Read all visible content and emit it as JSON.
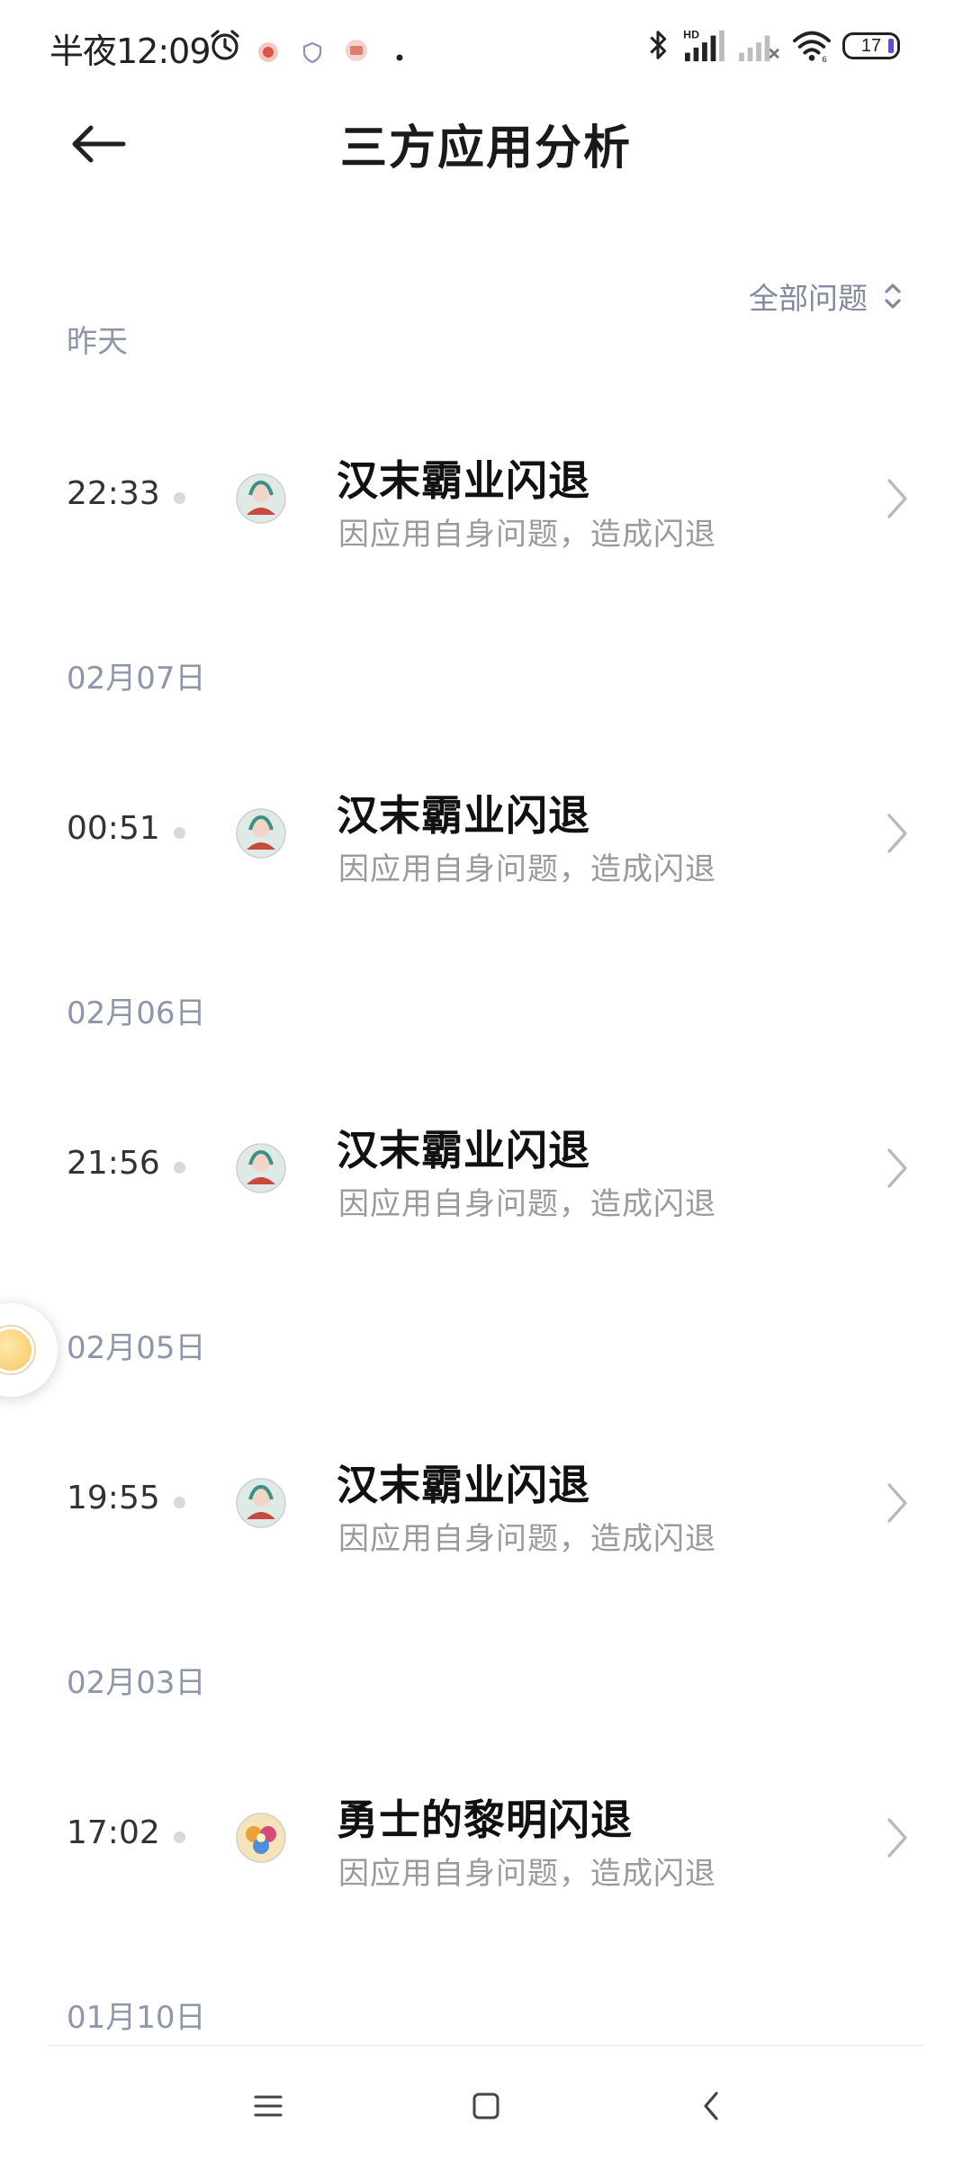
{
  "status_bar": {
    "time": "半夜12:09",
    "battery": "17",
    "icons": [
      "alarm-icon",
      "app-notification-icon",
      "shield-notification-icon",
      "app-notification-icon",
      "more-dot-icon",
      "bluetooth-icon",
      "signal-hd-icon",
      "signal-no-service-icon",
      "wifi-icon",
      "battery-icon"
    ]
  },
  "header": {
    "title": "三方应用分析",
    "back_icon": "arrow-left-icon"
  },
  "filter": {
    "label": "全部问题",
    "icon": "sort-updown-icon"
  },
  "sections": [
    {
      "date": "昨天",
      "items": [
        {
          "time": "22:33",
          "title": "汉末霸业闪退",
          "subtitle": "因应用自身问题，造成闪退",
          "icon": "app-icon-hanmo"
        }
      ]
    },
    {
      "date": "02月07日",
      "items": [
        {
          "time": "00:51",
          "title": "汉末霸业闪退",
          "subtitle": "因应用自身问题，造成闪退",
          "icon": "app-icon-hanmo"
        }
      ]
    },
    {
      "date": "02月06日",
      "items": [
        {
          "time": "21:56",
          "title": "汉末霸业闪退",
          "subtitle": "因应用自身问题，造成闪退",
          "icon": "app-icon-hanmo"
        }
      ]
    },
    {
      "date": "02月05日",
      "items": [
        {
          "time": "19:55",
          "title": "汉末霸业闪退",
          "subtitle": "因应用自身问题，造成闪退",
          "icon": "app-icon-hanmo"
        }
      ]
    },
    {
      "date": "02月03日",
      "items": [
        {
          "time": "17:02",
          "title": "勇士的黎明闪退",
          "subtitle": "因应用自身问题，造成闪退",
          "icon": "app-icon-yongshi"
        }
      ]
    },
    {
      "date": "01月10日",
      "items": []
    }
  ],
  "nav_bar": {
    "icons": [
      "menu-icon",
      "home-icon",
      "back-icon"
    ]
  },
  "colors": {
    "accent_gray": "#8d96aa",
    "title": "#111111",
    "subtitle": "#9a9a9a"
  }
}
